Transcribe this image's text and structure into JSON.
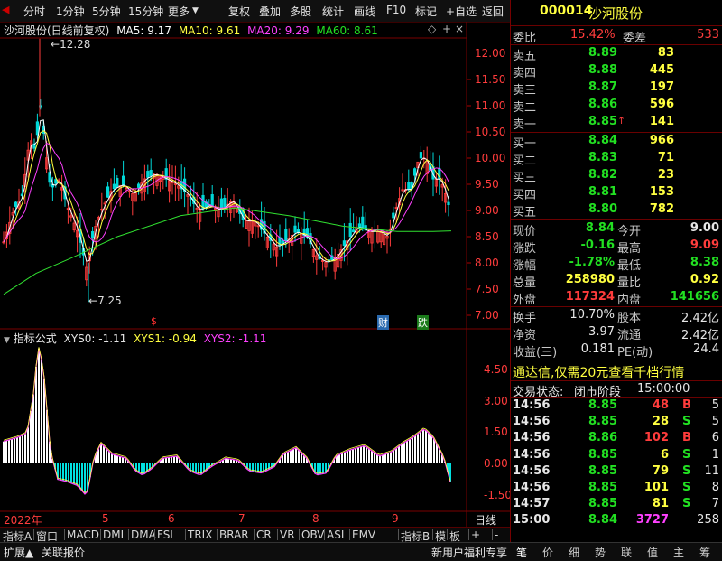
{
  "toolbar": {
    "left_items": [
      "分时",
      "1分钟",
      "5分钟",
      "15分钟",
      "更多"
    ],
    "right_items": [
      "复权",
      "叠加",
      "多股",
      "统计",
      "画线",
      "F10",
      "标记",
      "+自选",
      "返回"
    ]
  },
  "chart": {
    "legend": {
      "stock": "沙河股份(日线前复权)",
      "ma5": "MA5: 9.17",
      "ma10": "MA10: 9.61",
      "ma20": "MA20: 9.29",
      "ma60": "MA60: 8.61"
    },
    "price_axis": [
      "12.00",
      "11.50",
      "11.00",
      "10.50",
      "10.00",
      "9.50",
      "9.00",
      "8.50",
      "8.00",
      "7.50",
      "7.00"
    ],
    "high_marker": "12.28",
    "low_marker": "7.25",
    "event_markers": [
      "$",
      "财",
      "跌"
    ],
    "indicator_legend": {
      "name": "指标公式",
      "xys0": "XYS0: -1.11",
      "xys1": "XYS1: -0.94",
      "xys2": "XYS2: -1.11"
    },
    "indicator_axis": [
      "4.50",
      "3.00",
      "1.50",
      "0.00",
      "-1.50"
    ],
    "time_axis": [
      "2022年",
      "5",
      "6",
      "7",
      "8",
      "9"
    ],
    "period_label": "日线"
  },
  "tabs": [
    "指标A",
    "窗口",
    "MACD",
    "DMI",
    "DMA",
    "FSL",
    "TRIX",
    "BRAR",
    "CR",
    "VR",
    "OBV",
    "ASI",
    "EMV",
    "指标B",
    "模",
    "板",
    "+",
    "-"
  ],
  "status": {
    "expand": "扩展▲",
    "related": "关联报价",
    "promo": "新用户福利专享",
    "icons": [
      "笔",
      "价",
      "细",
      "势",
      "联",
      "值",
      "主",
      "筹"
    ]
  },
  "quote": {
    "code": "000014",
    "name": "沙河股份",
    "webi_label": "委比",
    "webi": "15.42%",
    "weicha_label": "委差",
    "weicha": "533",
    "asks": [
      {
        "label": "卖五",
        "price": "8.89",
        "vol": "83"
      },
      {
        "label": "卖四",
        "price": "8.88",
        "vol": "445"
      },
      {
        "label": "卖三",
        "price": "8.87",
        "vol": "197"
      },
      {
        "label": "卖二",
        "price": "8.86",
        "vol": "596"
      },
      {
        "label": "卖一",
        "price": "8.85",
        "vol": "141"
      }
    ],
    "bids": [
      {
        "label": "买一",
        "price": "8.84",
        "vol": "966"
      },
      {
        "label": "买二",
        "price": "8.83",
        "vol": "71"
      },
      {
        "label": "买三",
        "price": "8.82",
        "vol": "23"
      },
      {
        "label": "买四",
        "price": "8.81",
        "vol": "153"
      },
      {
        "label": "买五",
        "price": "8.80",
        "vol": "782"
      }
    ],
    "stats": [
      {
        "l1": "现价",
        "v1": "8.84",
        "l2": "今开",
        "v2": "9.00"
      },
      {
        "l1": "涨跌",
        "v1": "-0.16",
        "l2": "最高",
        "v2": "9.09"
      },
      {
        "l1": "涨幅",
        "v1": "-1.78%",
        "l2": "最低",
        "v2": "8.38"
      },
      {
        "l1": "总量",
        "v1": "258980",
        "l2": "量比",
        "v2": "0.92"
      },
      {
        "l1": "外盘",
        "v1": "117324",
        "l2": "内盘",
        "v2": "141656"
      }
    ],
    "stats2": [
      {
        "l1": "换手",
        "v1": "10.70%",
        "l2": "股本",
        "v2": "2.42亿"
      },
      {
        "l1": "净资",
        "v1": "3.97",
        "l2": "流通",
        "v2": "2.42亿"
      },
      {
        "l1": "收益(三)",
        "v1": "0.181",
        "l2": "PE(动)",
        "v2": "24.4"
      }
    ],
    "ad": "通达信,仅需20元查看千档行情",
    "trade_state_label": "交易状态:",
    "trade_state": "闭市阶段",
    "trade_time": "15:00:00",
    "ticks": [
      {
        "t": "14:56",
        "p": "8.85",
        "v": "48",
        "s": "B",
        "n": "5"
      },
      {
        "t": "14:56",
        "p": "8.85",
        "v": "28",
        "s": "S",
        "n": "5"
      },
      {
        "t": "14:56",
        "p": "8.86",
        "v": "102",
        "s": "B",
        "n": "6"
      },
      {
        "t": "14:56",
        "p": "8.85",
        "v": "6",
        "s": "S",
        "n": "1"
      },
      {
        "t": "14:56",
        "p": "8.85",
        "v": "79",
        "s": "S",
        "n": "11"
      },
      {
        "t": "14:56",
        "p": "8.85",
        "v": "101",
        "s": "S",
        "n": "8"
      },
      {
        "t": "14:57",
        "p": "8.85",
        "v": "81",
        "s": "S",
        "n": "7"
      },
      {
        "t": "15:00",
        "p": "8.84",
        "v": "3727",
        "s": "",
        "n": "258"
      }
    ]
  }
}
